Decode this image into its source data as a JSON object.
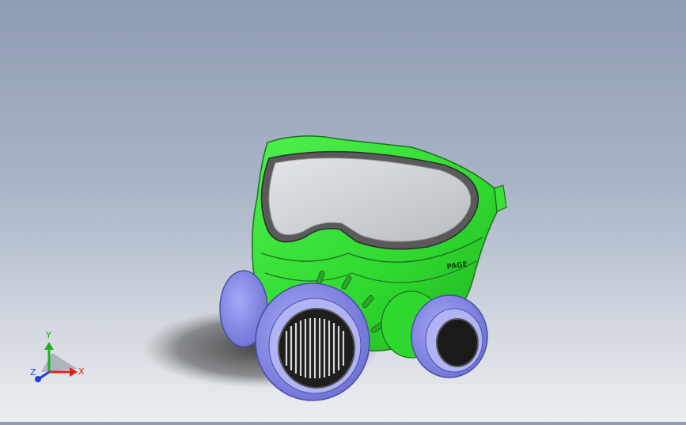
{
  "viewport": {
    "model": "gas-mask",
    "background": {
      "top": "#8e9cb4",
      "bottom": "#eceef1"
    }
  },
  "model_text": {
    "brand": "PAGE"
  },
  "triad": {
    "x_label": "X",
    "y_label": "Y",
    "z_label": "Z",
    "colors": {
      "x": "#e02020",
      "y": "#20b020",
      "z": "#2040e0"
    }
  },
  "colors": {
    "mask_body": "#35e035",
    "mask_outline": "#1f6f1f",
    "filter": "#8a8ff0",
    "filter_dark": "#5559b8",
    "lens": "#cfd3d8",
    "frame": "#8a8a8a"
  }
}
